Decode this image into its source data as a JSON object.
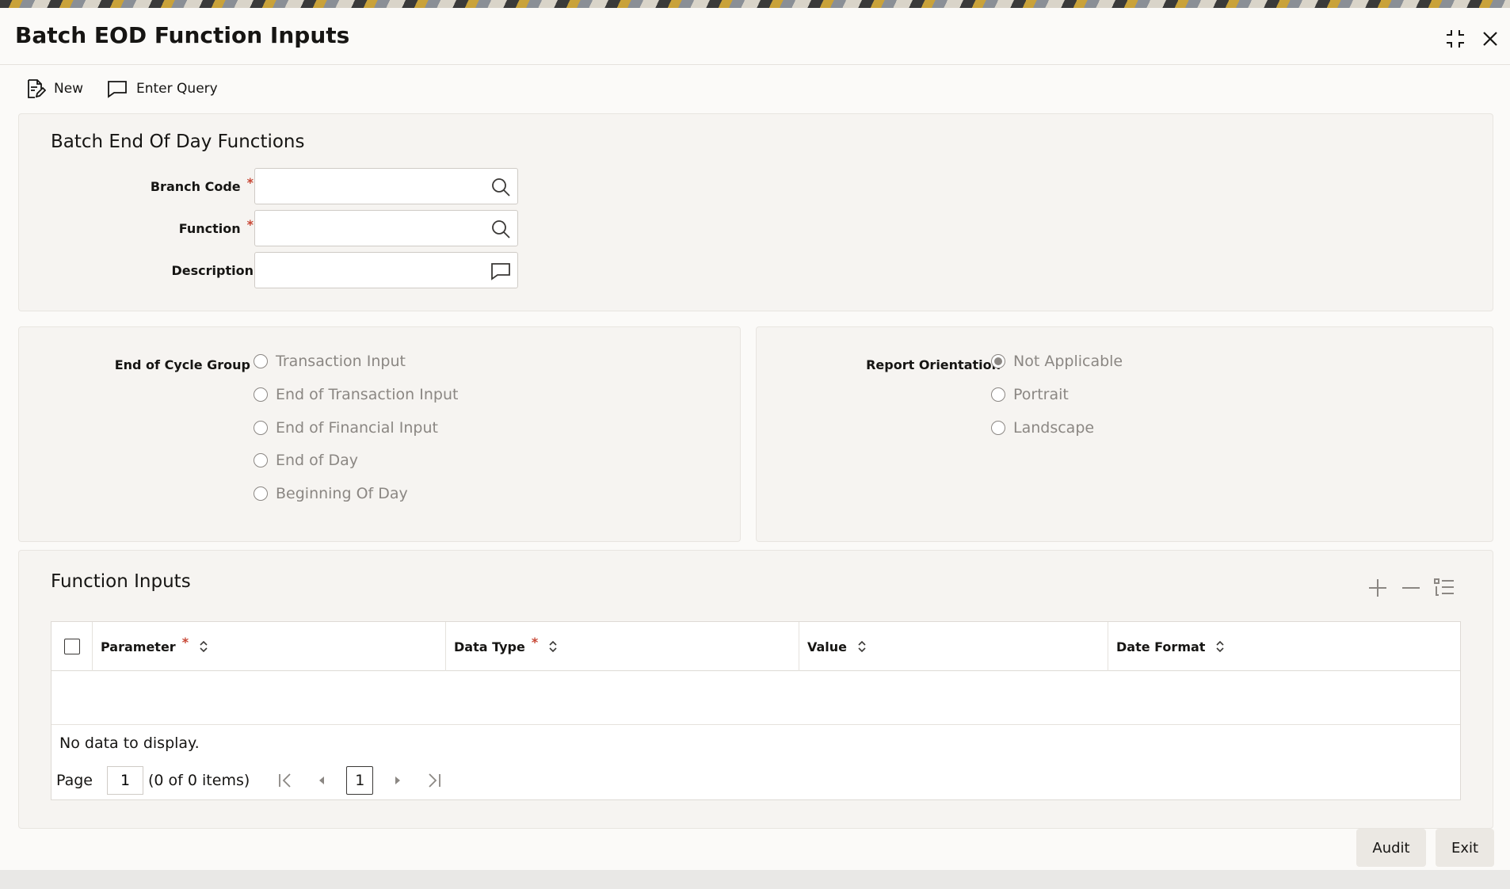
{
  "window": {
    "title": "Batch EOD Function Inputs"
  },
  "toolbar": {
    "new_label": "New",
    "enter_query_label": "Enter Query"
  },
  "main_section": {
    "title": "Batch End Of Day Functions",
    "branch_code": {
      "label": "Branch Code",
      "required_mark": "*",
      "value": ""
    },
    "function": {
      "label": "Function",
      "required_mark": "*",
      "value": ""
    },
    "description": {
      "label": "Description",
      "value": ""
    }
  },
  "end_of_cycle": {
    "label": "End of Cycle Group",
    "options": [
      "Transaction Input",
      "End of Transaction Input",
      "End of Financial Input",
      "End of Day",
      "Beginning Of Day"
    ],
    "selected": ""
  },
  "report_orientation": {
    "label": "Report Orientation",
    "options": [
      "Not Applicable",
      "Portrait",
      "Landscape"
    ],
    "selected": "Not Applicable"
  },
  "function_inputs": {
    "title": "Function Inputs",
    "columns": [
      {
        "label": "Parameter",
        "required_mark": "*"
      },
      {
        "label": "Data Type",
        "required_mark": "*"
      },
      {
        "label": "Value",
        "required_mark": ""
      },
      {
        "label": "Date Format",
        "required_mark": ""
      }
    ],
    "rows": [],
    "empty_text": "No data to display.",
    "pager": {
      "page_label": "Page",
      "page_value": "1",
      "items_text": "(0 of 0 items)",
      "current_page": "1"
    }
  },
  "footer": {
    "audit_label": "Audit",
    "exit_label": "Exit"
  },
  "colors": {
    "accent_required": "#c74634",
    "panel_bg": "#f6f4f1",
    "text_disabled": "#8b8783"
  }
}
